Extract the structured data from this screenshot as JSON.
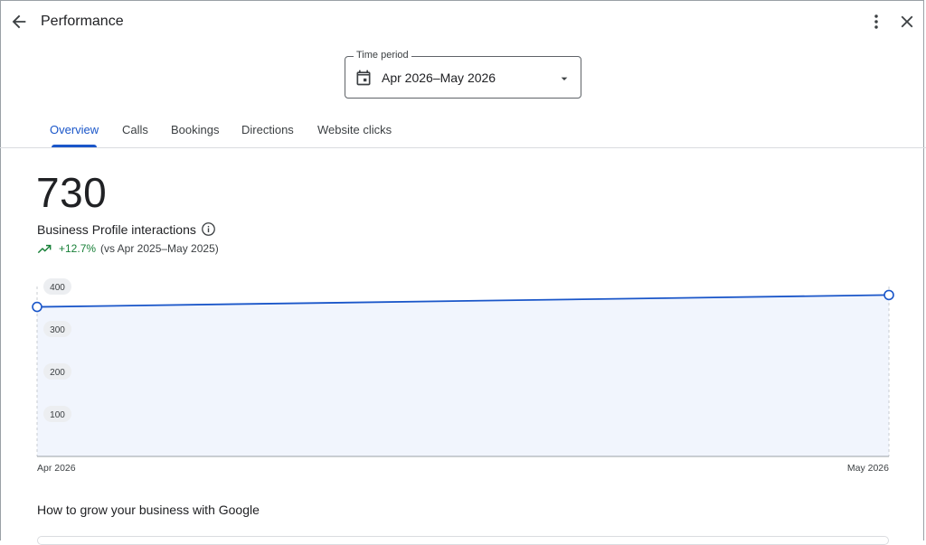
{
  "header": {
    "title": "Performance"
  },
  "time_period": {
    "label": "Time period",
    "value": "Apr 2026–May 2026"
  },
  "tabs": [
    {
      "label": "Overview",
      "active": true
    },
    {
      "label": "Calls",
      "active": false
    },
    {
      "label": "Bookings",
      "active": false
    },
    {
      "label": "Directions",
      "active": false
    },
    {
      "label": "Website clicks",
      "active": false
    }
  ],
  "summary": {
    "total": "730",
    "label": "Business Profile interactions",
    "change": "+12.7%",
    "comparison": "(vs Apr 2025–May 2025)"
  },
  "section": {
    "title": "How to grow your business with Google"
  },
  "icons": {
    "back": "arrow-back-icon",
    "more": "more-vert-icon",
    "close": "close-icon",
    "calendar": "calendar-icon",
    "dropdown": "dropdown-arrow-icon",
    "info": "info-icon",
    "trend": "trending-up-icon"
  },
  "colors": {
    "accent": "#1a56c9",
    "positive": "#188038",
    "area_fill": "#f1f5fd"
  },
  "chart_data": {
    "type": "area",
    "x": [
      "Apr 2026",
      "May 2026"
    ],
    "series": [
      {
        "values": [
          352,
          380
        ]
      }
    ],
    "y_ticks": [
      "400",
      "300",
      "200",
      "100"
    ],
    "ylim": [
      0,
      400
    ],
    "grid": false,
    "legend": "none"
  }
}
